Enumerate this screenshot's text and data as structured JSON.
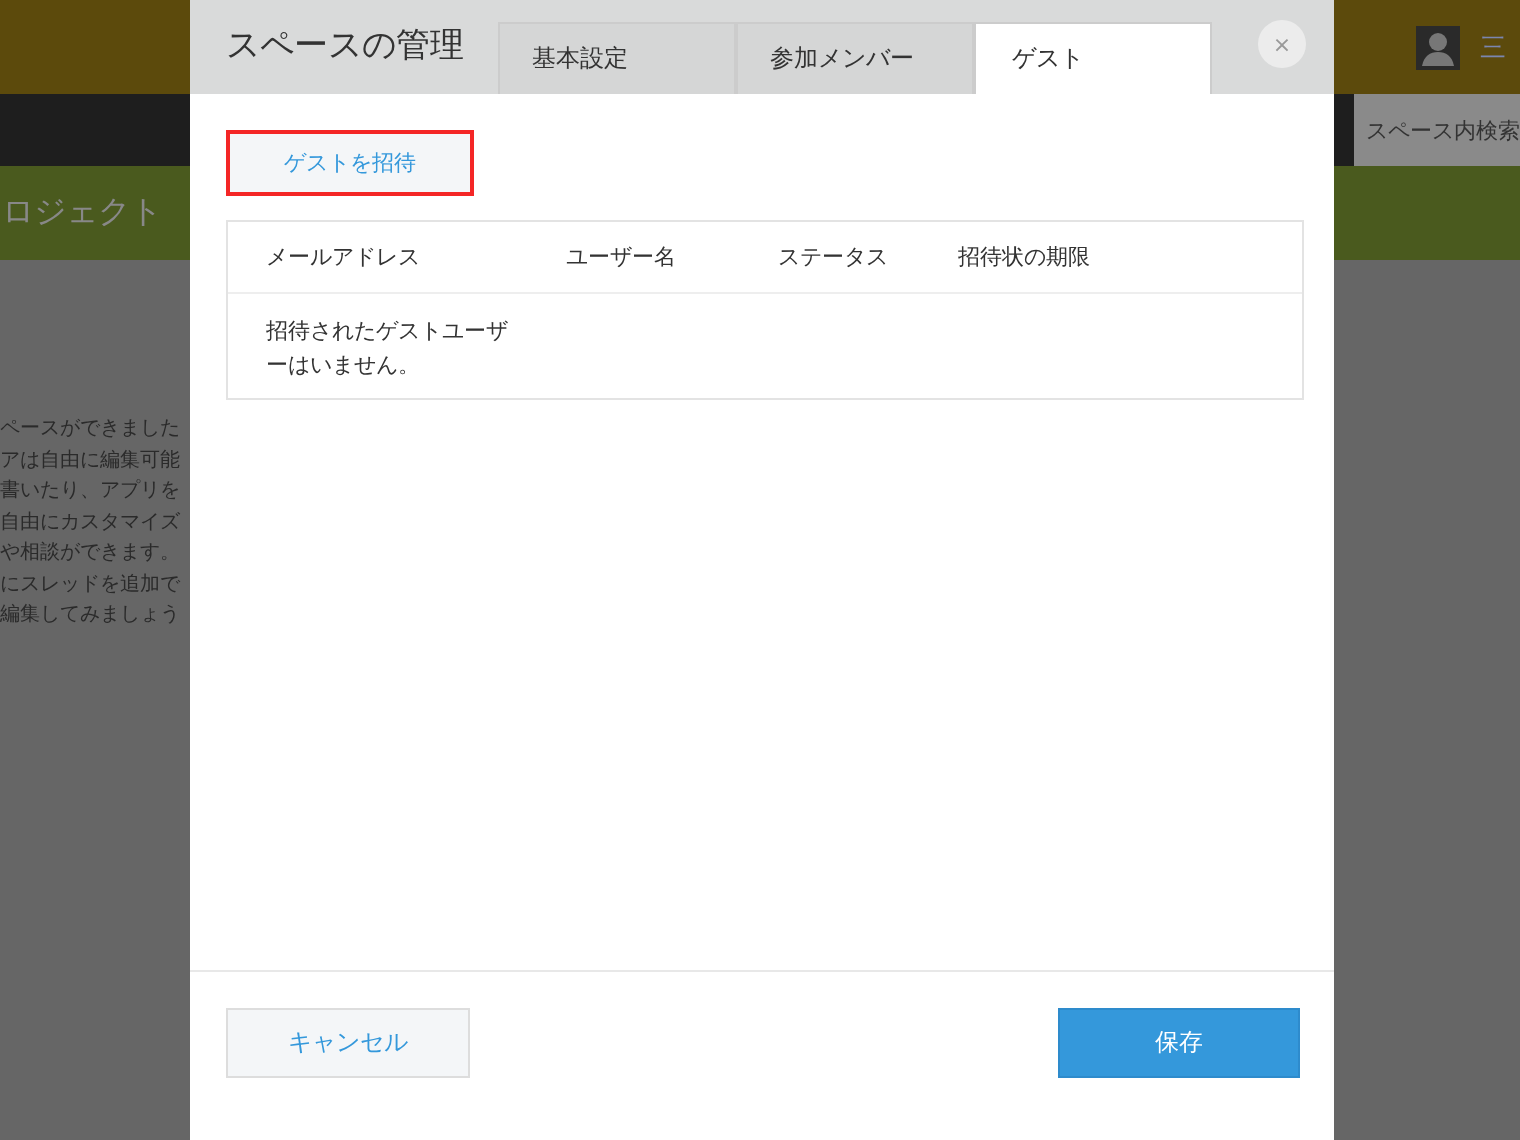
{
  "background_page": {
    "user_name": "三",
    "search_placeholder": "スペース内検索",
    "space_title": "ロジェクト",
    "intro_lines": [
      "ペースができました",
      "アは自由に編集可能",
      "書いたり、アプリを",
      "自由にカスタマイズ",
      "や相談ができます。",
      "にスレッドを追加で",
      "編集してみましょう"
    ]
  },
  "dialog": {
    "title": "スペースの管理",
    "tabs": [
      {
        "label": "基本設定",
        "selected": false
      },
      {
        "label": "参加メンバー",
        "selected": false
      },
      {
        "label": "ゲスト",
        "selected": true
      }
    ],
    "close_label": "×",
    "invite_button": {
      "label": "ゲストを招待",
      "highlighted": true
    },
    "table": {
      "columns": [
        "メールアドレス",
        "ユーザー名",
        "ステータス",
        "招待状の期限"
      ],
      "empty_message": "招待されたゲストユーザーはいません。"
    },
    "buttons": {
      "cancel": "キャンセル",
      "save": "保存"
    }
  }
}
